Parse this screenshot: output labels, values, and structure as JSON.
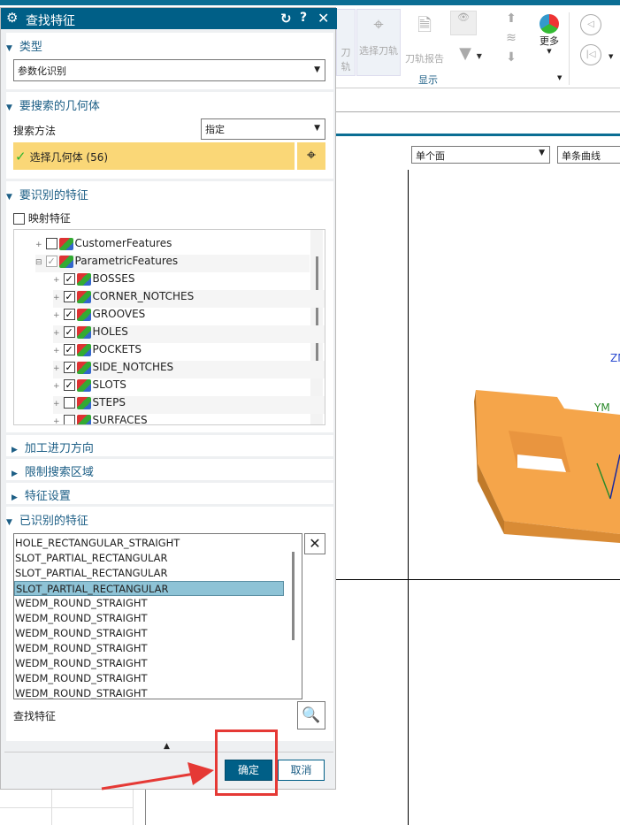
{
  "dialog": {
    "title": "查找特征",
    "type_section": {
      "label": "类型",
      "value": "参数化识别"
    },
    "geometry_section": {
      "label": "要搜索的几何体",
      "method_label": "搜索方法",
      "method_value": "指定",
      "select_label": "选择几何体 (56)"
    },
    "features_section": {
      "label": "要识别的特征",
      "map_label": "映射特征",
      "tree": [
        {
          "label": "CustomerFeatures",
          "checked": false,
          "level": 1
        },
        {
          "label": "ParametricFeatures",
          "checked": true,
          "level": 1,
          "grayed": true
        },
        {
          "label": "BOSSES",
          "checked": true,
          "level": 2
        },
        {
          "label": "CORNER_NOTCHES",
          "checked": true,
          "level": 2
        },
        {
          "label": "GROOVES",
          "checked": true,
          "level": 2
        },
        {
          "label": "HOLES",
          "checked": true,
          "level": 2
        },
        {
          "label": "POCKETS",
          "checked": true,
          "level": 2
        },
        {
          "label": "SIDE_NOTCHES",
          "checked": true,
          "level": 2
        },
        {
          "label": "SLOTS",
          "checked": true,
          "level": 2
        },
        {
          "label": "STEPS",
          "checked": false,
          "level": 2
        },
        {
          "label": "SURFACES",
          "checked": false,
          "level": 2
        }
      ]
    },
    "collapsed_sections": [
      "加工进刀方向",
      "限制搜索区域",
      "特征设置"
    ],
    "recognized_section": {
      "label": "已识别的特征",
      "items": [
        "HOLE_RECTANGULAR_STRAIGHT",
        "SLOT_PARTIAL_RECTANGULAR",
        "SLOT_PARTIAL_RECTANGULAR",
        "SLOT_PARTIAL_RECTANGULAR",
        "WEDM_ROUND_STRAIGHT",
        "WEDM_ROUND_STRAIGHT",
        "WEDM_ROUND_STRAIGHT",
        "WEDM_ROUND_STRAIGHT",
        "WEDM_ROUND_STRAIGHT",
        "WEDM_ROUND_STRAIGHT",
        "WEDM_ROUND_STRAIGHT"
      ],
      "selected_index": 3,
      "find_label": "查找特征"
    },
    "ok_label": "确定",
    "cancel_label": "取消"
  },
  "ribbon": {
    "btn1": "刀轨",
    "btn2": "选择刀轨",
    "btn3": "刀轨报告",
    "more": "更多",
    "group": "显示"
  },
  "filters": {
    "face": "单个面",
    "curve": "单条曲线"
  },
  "viewport": {
    "zm": "ZM",
    "ym": "YM"
  },
  "colors": {
    "accent": "#005f87",
    "highlight": "#fad777",
    "part": "#f5a54a",
    "selected_row": "#8ec3d6",
    "annotation": "#e53935"
  }
}
